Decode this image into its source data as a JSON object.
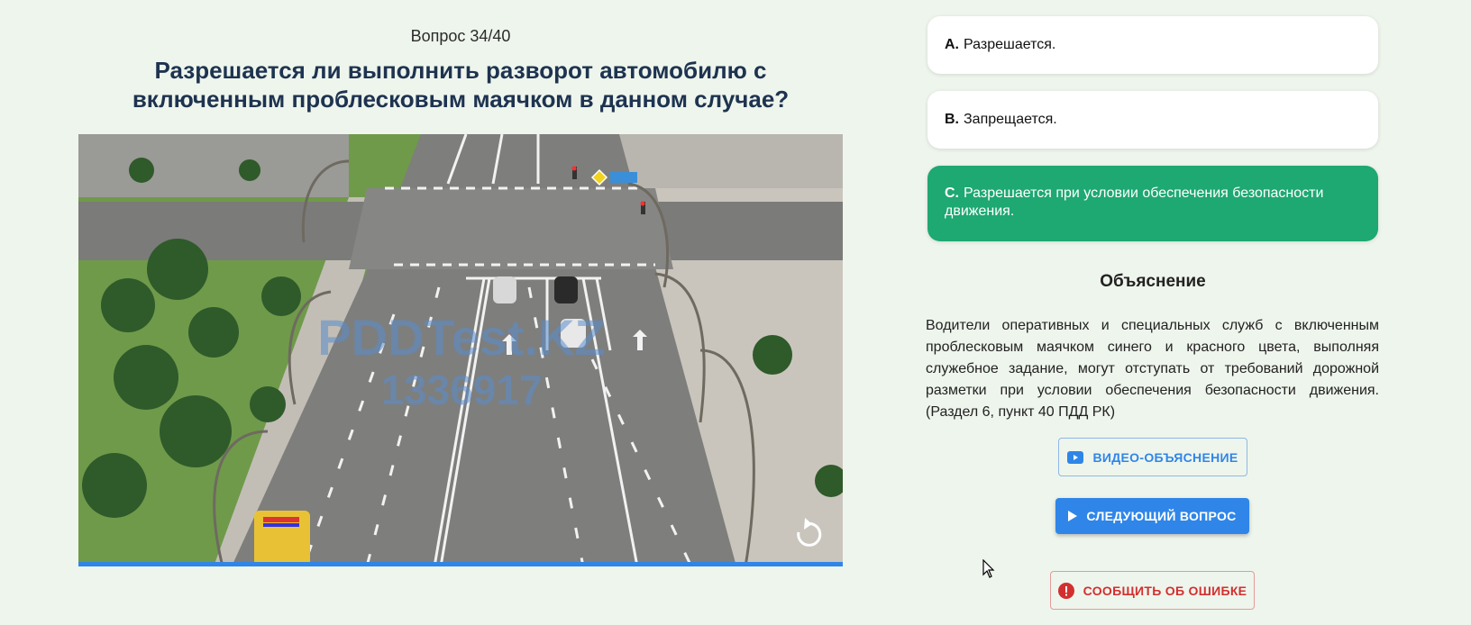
{
  "question": {
    "counter": "Вопрос 34/40",
    "text": "Разрешается ли выполнить разворот автомобилю с включенным проблесковым маячком в данном случае?"
  },
  "media": {
    "watermark_line1": "PDDTest.KZ",
    "watermark_line2": "1336917",
    "replay_icon": "replay-icon",
    "progress_percent": 100
  },
  "answers": [
    {
      "letter": "A.",
      "text": "Разрешается.",
      "correct": false
    },
    {
      "letter": "B.",
      "text": "Запрещается.",
      "correct": false
    },
    {
      "letter": "C.",
      "text": "Разрешается при условии обеспечения безопасности движения.",
      "correct": true
    }
  ],
  "explanation": {
    "title": "Объяснение",
    "text": "Водители оперативных и специальных служб с включенным проблесковым маячком синего и красного цвета, выполняя служебное задание, могут отступать от требований дорожной разметки при условии обеспечения безопасности движения. (Раздел 6, пункт 40 ПДД РК)"
  },
  "buttons": {
    "video": "ВИДЕО-ОБЪЯСНЕНИЕ",
    "next": "СЛЕДУЮЩИЙ ВОПРОС",
    "report": "СООБЩИТЬ ОБ ОШИБКЕ"
  },
  "colors": {
    "background": "#eef5ec",
    "accent_blue": "#2f86e8",
    "correct_green": "#1ea872",
    "error_red": "#d32f2f",
    "title_navy": "#1e3350"
  }
}
